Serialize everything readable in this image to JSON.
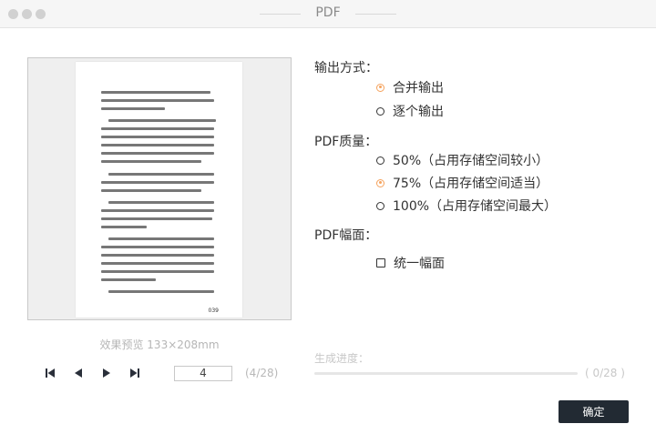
{
  "window": {
    "title": "PDF"
  },
  "preview": {
    "caption_prefix": "效果预览",
    "caption_size": "133×208mm",
    "page_footer": "039",
    "current_page": "4",
    "page_total": "(4/28)"
  },
  "output_mode": {
    "label": "输出方式：",
    "options": [
      {
        "label": "合并输出",
        "selected": true
      },
      {
        "label": "逐个输出",
        "selected": false
      }
    ]
  },
  "quality": {
    "label": "PDF质量：",
    "options": [
      {
        "label": "50%（占用存储空间较小）",
        "selected": false
      },
      {
        "label": "75%（占用存储空间适当）",
        "selected": true
      },
      {
        "label": "100%（占用存储空间最大）",
        "selected": false
      }
    ]
  },
  "page_size": {
    "label": "PDF幅面：",
    "checkbox_label": "统一幅面",
    "checked": false
  },
  "progress": {
    "label": "生成进度：",
    "fraction": 0,
    "count": "( 0/28 )"
  },
  "actions": {
    "confirm": "确定"
  },
  "colors": {
    "accent": "#f5a25d",
    "button_bg": "#222a33"
  },
  "icons": [
    "first-page-icon",
    "prev-page-icon",
    "next-page-icon",
    "last-page-icon"
  ]
}
